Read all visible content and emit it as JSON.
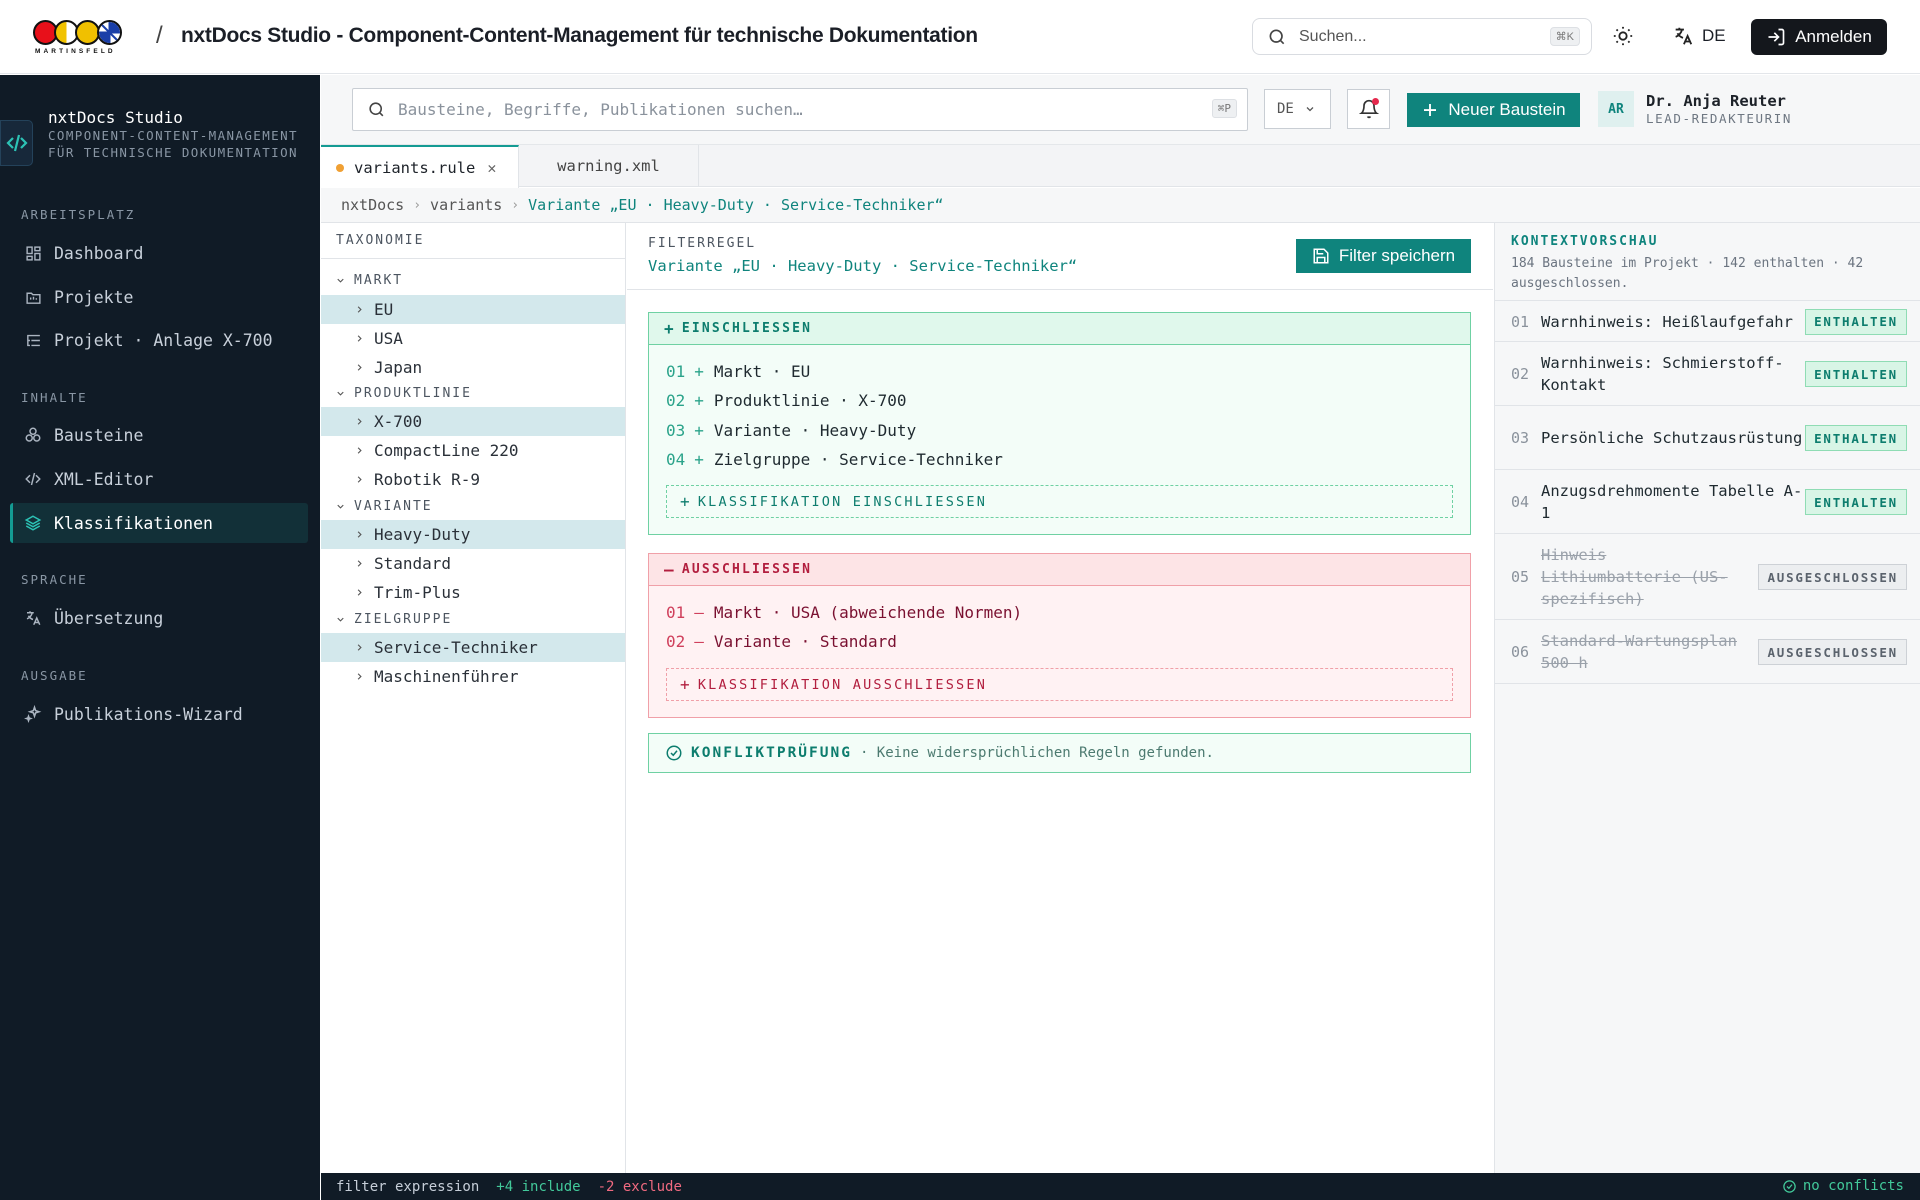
{
  "app": {
    "logo_wordmark": "MARTINSFELD",
    "separator": "/",
    "title": "nxtDocs Studio - Component-Content-Management für technische Dokumentation"
  },
  "topbar": {
    "search_placeholder": "Suchen...",
    "search_shortcut": "⌘K",
    "language": "DE",
    "login_label": "Anmelden"
  },
  "sidebar": {
    "brand_name": "nxtDocs Studio",
    "brand_subtitle": "COMPONENT-CONTENT-MANAGEMENT FÜR TECHNISCHE DOKUMENTATION",
    "sections": [
      {
        "title": "ARBEITSPLATZ",
        "items": [
          {
            "label": "Dashboard",
            "icon": "dashboard-icon"
          },
          {
            "label": "Projekte",
            "icon": "folder-icon"
          },
          {
            "label": "Projekt · Anlage X-700",
            "icon": "list-tree-icon"
          }
        ]
      },
      {
        "title": "INHALTE",
        "items": [
          {
            "label": "Bausteine",
            "icon": "blocks-icon"
          },
          {
            "label": "XML-Editor",
            "icon": "code-icon"
          },
          {
            "label": "Klassifikationen",
            "icon": "layers-icon",
            "active": true
          }
        ]
      },
      {
        "title": "SPRACHE",
        "items": [
          {
            "label": "Übersetzung",
            "icon": "translate-icon"
          }
        ]
      },
      {
        "title": "AUSGABE",
        "items": [
          {
            "label": "Publikations-Wizard",
            "icon": "sparkle-icon"
          }
        ]
      }
    ]
  },
  "toolbar": {
    "search_placeholder": "Bausteine, Begriffe, Publikationen suchen…",
    "search_shortcut": "⌘P",
    "language": "DE",
    "new_button": "Neuer Baustein",
    "user_initials": "AR",
    "user_name": "Dr. Anja Reuter",
    "user_role": "LEAD-REDAKTEURIN"
  },
  "tabs": [
    {
      "label": "variants.rule",
      "active": true,
      "modified": true
    },
    {
      "label": "warning.xml",
      "active": false
    }
  ],
  "breadcrumb": [
    "nxtDocs",
    "variants",
    "Variante „EU · Heavy-Duty · Service-Techniker“"
  ],
  "taxonomy": {
    "header": "TAXONOMIE",
    "groups": [
      {
        "label": "MARKT",
        "items": [
          {
            "label": "EU",
            "selected": true
          },
          {
            "label": "USA",
            "selected": false
          },
          {
            "label": "Japan",
            "selected": false
          }
        ]
      },
      {
        "label": "PRODUKTLINIE",
        "items": [
          {
            "label": "X-700",
            "selected": true
          },
          {
            "label": "CompactLine 220",
            "selected": false
          },
          {
            "label": "Robotik R-9",
            "selected": false
          }
        ]
      },
      {
        "label": "VARIANTE",
        "items": [
          {
            "label": "Heavy-Duty",
            "selected": true
          },
          {
            "label": "Standard",
            "selected": false
          },
          {
            "label": "Trim-Plus",
            "selected": false
          }
        ]
      },
      {
        "label": "ZIELGRUPPE",
        "items": [
          {
            "label": "Service-Techniker",
            "selected": true
          },
          {
            "label": "Maschinenführer",
            "selected": false
          }
        ]
      }
    ]
  },
  "filter": {
    "kicker": "FILTERREGEL",
    "title": "Variante „EU · Heavy-Duty · Service-Techniker“",
    "save_button": "Filter speichern",
    "include": {
      "header": "EINSCHLIESSEN",
      "rules": [
        {
          "num": "01",
          "text": "Markt · EU"
        },
        {
          "num": "02",
          "text": "Produktlinie · X-700"
        },
        {
          "num": "03",
          "text": "Variante · Heavy-Duty"
        },
        {
          "num": "04",
          "text": "Zielgruppe · Service-Techniker"
        }
      ],
      "add_label": "KLASSIFIKATION EINSCHLIESSEN"
    },
    "exclude": {
      "header": "AUSSCHLIESSEN",
      "rules": [
        {
          "num": "01",
          "text": "Markt · USA (abweichende Normen)"
        },
        {
          "num": "02",
          "text": "Variante · Standard"
        }
      ],
      "add_label": "KLASSIFIKATION AUSSCHLIESSEN"
    },
    "conflict_title": "KONFLIKTPRÜFUNG",
    "conflict_text": "· Keine widersprüchlichen Regeln gefunden."
  },
  "context": {
    "header": "KONTEXTVORSCHAU",
    "summary": "184 Bausteine im Projekt · 142 enthalten · 42 ausgeschlossen.",
    "items": [
      {
        "num": "01",
        "title": "Warnhinweis: Heißlaufgefahr",
        "status": "ENTHALTEN",
        "included": true
      },
      {
        "num": "02",
        "title": "Warnhinweis: Schmierstoff-Kontakt",
        "status": "ENTHALTEN",
        "included": true
      },
      {
        "num": "03",
        "title": "Persönliche Schutzausrüstung",
        "status": "ENTHALTEN",
        "included": true
      },
      {
        "num": "04",
        "title": "Anzugsdrehmomente Tabelle A-1",
        "status": "ENTHALTEN",
        "included": true
      },
      {
        "num": "05",
        "title": "Hinweis Lithiumbatterie (US-spezifisch)",
        "status": "AUSGESCHLOSSEN",
        "included": false
      },
      {
        "num": "06",
        "title": "Standard-Wartungsplan 500 h",
        "status": "AUSGESCHLOSSEN",
        "included": false
      }
    ]
  },
  "statusbar": {
    "label": "filter expression",
    "include": "+4 include",
    "exclude": "-2 exclude",
    "conflicts": "no conflicts"
  },
  "colors": {
    "accent": "#0f847d",
    "sidebar_bg": "#101b26",
    "include": "#6fd1a3",
    "exclude": "#f0a0a8"
  }
}
